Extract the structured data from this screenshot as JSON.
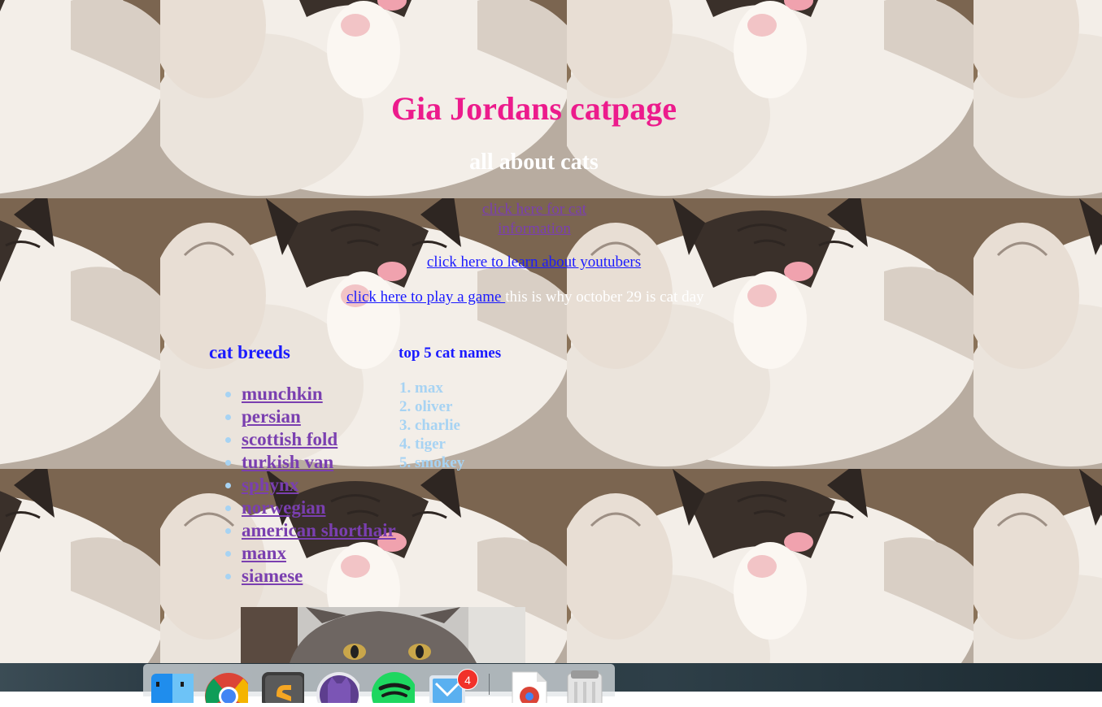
{
  "page": {
    "title": "Gia Jordans catpage",
    "subtitle": "all about cats",
    "title_color": "#ec1b8c",
    "link_visited_color": "#7a3fb0",
    "link_color": "#1a1aff"
  },
  "nav": {
    "cat_info_link": "click here for cat information",
    "youtubers_link": "click here to learn about youtubers",
    "game_link": "click here to play a game ",
    "cat_day_text": "this is why october 29 is cat day"
  },
  "breeds": {
    "heading": "cat breeds",
    "items": [
      "munchkin",
      "persian",
      "scottish fold",
      "turkish van",
      "sphynx",
      "norwegian",
      "american shorthair",
      "manx",
      "siamese"
    ]
  },
  "cat_names": {
    "heading": "top 5 cat names",
    "items": [
      "max",
      "oliver",
      "charlie",
      "tiger",
      "smokey"
    ]
  },
  "dock": {
    "apps": [
      "finder-icon",
      "chrome-icon",
      "sublime-text-icon",
      "alfred-icon",
      "spotify-icon",
      "mail-icon",
      "chrome-document-icon",
      "trash-icon"
    ],
    "mail_badge": "4"
  }
}
